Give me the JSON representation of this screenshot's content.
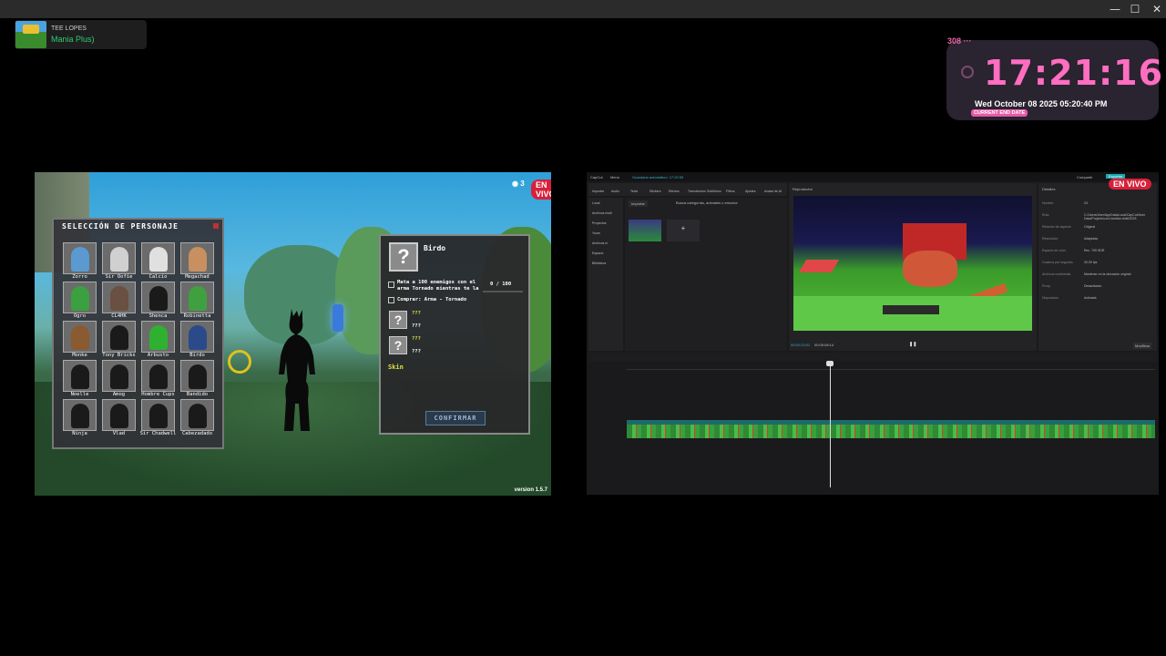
{
  "window_controls": {
    "minimize": "—",
    "maximize": "☐",
    "close": "✕"
  },
  "now_playing": {
    "artist": "TEE LOPES",
    "song": "Mania Plus)"
  },
  "clock": {
    "counter": "308 ···",
    "time": "17:21:16",
    "date": "Wed October 08 2025 05:20:40 PM",
    "badge": "CURRENT END DATE"
  },
  "game": {
    "live_badge": "EN VIVO",
    "live_count": "3",
    "version": "version 1.5.7",
    "character_panel": {
      "title": "SELECCIÓN DE PERSONAJE",
      "slots": [
        {
          "name": "Zorro",
          "color": "#5a9ad0"
        },
        {
          "name": "Sir Oofie",
          "color": "#d0d0d0"
        },
        {
          "name": "Calcio",
          "color": "#e0e0e0"
        },
        {
          "name": "Megachad",
          "color": "#c89060"
        },
        {
          "name": "Ogro",
          "color": "#3aa040"
        },
        {
          "name": "CL4HK",
          "color": "#6a5040"
        },
        {
          "name": "Shenca",
          "color": "#1a1a1a"
        },
        {
          "name": "Robinetta",
          "color": "#40a040"
        },
        {
          "name": "Monke",
          "color": "#8a5a30"
        },
        {
          "name": "Tony Bricks",
          "color": "#1a1a1a"
        },
        {
          "name": "Arbusto",
          "color": "#30b030"
        },
        {
          "name": "Birdo",
          "color": "#2a4a8a"
        },
        {
          "name": "Noelle",
          "color": "#1a1a1a"
        },
        {
          "name": "Amog",
          "color": "#1a1a1a"
        },
        {
          "name": "Hombre Cups",
          "color": "#1a1a1a"
        },
        {
          "name": "Bandido",
          "color": "#1a1a1a"
        },
        {
          "name": "Ninja",
          "color": "#1a1a1a"
        },
        {
          "name": "Vlad",
          "color": "#1a1a1a"
        },
        {
          "name": "Sir Chadwell",
          "color": "#1a1a1a"
        },
        {
          "name": "Cabezadado",
          "color": "#1a1a1a"
        }
      ]
    },
    "info_panel": {
      "name": "Birdo",
      "mission": "Mata a 100 enemigos con el arma Tornado mientras te la",
      "progress": "0 / 100",
      "purchase": "Comprar: Arma - Tornado",
      "unknown_1": "???",
      "unknown_1_sub": "???",
      "unknown_2": "???",
      "unknown_2_sub": "???",
      "skin": "Skin",
      "confirm": "CONFIRMAR"
    }
  },
  "editor": {
    "live_badge": "EN VIVO",
    "app_menu": "CapCut",
    "menu": "Menú",
    "autosave": "Guardado automático: 17:20:59",
    "toolbar_items": [
      "Importar",
      "Audio",
      "Texto",
      "Stickers",
      "Efectos",
      "Transiciones",
      "Subtítulos",
      "Filtros",
      "Ajustes",
      "Avatar de AI"
    ],
    "sidebar_items": [
      "Local",
      "Archivos multi",
      "Proyectos",
      "Yours",
      "Archivos m",
      "Espacio",
      "Biblioteca"
    ],
    "import_button": "Importar",
    "search_placeholder": "Busca categorías, animales o emociones",
    "player_title": "Reproductor",
    "details_title": "Detalles",
    "details": [
      {
        "key": "Nombre",
        "value": "03"
      },
      {
        "key": "Ruta",
        "value": "C:/Users/User/AppData/Local/CapCut/User Data/Projects/com.lveditor.draft/2025"
      },
      {
        "key": "Relación de aspecto",
        "value": "Original"
      },
      {
        "key": "Resolución",
        "value": "Adaptada"
      },
      {
        "key": "Espacio de color",
        "value": "Rec. 709 SDR"
      },
      {
        "key": "Cuadros por segundo",
        "value": "30.00 fps"
      },
      {
        "key": "Archivos multimedia",
        "value": "Mantener en la ubicación original"
      },
      {
        "key": "Proxy",
        "value": "Desactivado"
      },
      {
        "key": "Disposición",
        "value": "Activada"
      }
    ],
    "modify_button": "Modificar",
    "export_button": "Exportar",
    "share_button": "Compartir",
    "timecode": "00:02:23:01",
    "duration": "00:05:08:14"
  }
}
